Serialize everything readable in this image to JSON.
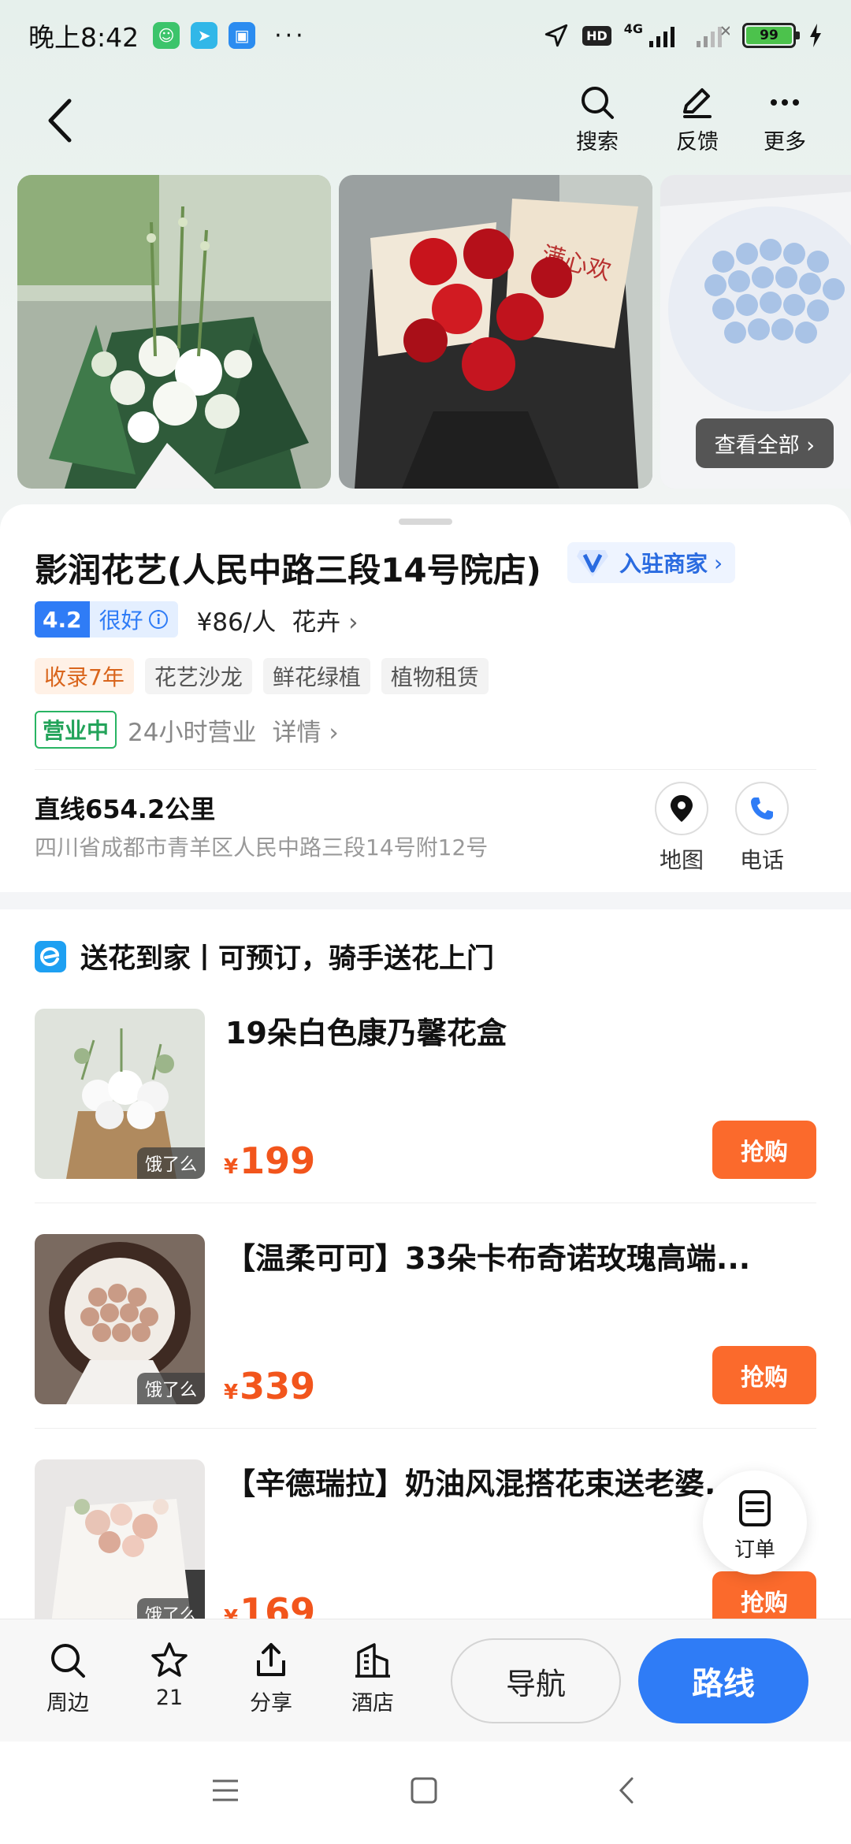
{
  "status_bar": {
    "time": "晚上8:42",
    "network": "4G",
    "hd": "HD",
    "battery": "99",
    "dots": "···"
  },
  "header": {
    "actions": [
      {
        "label": "搜索",
        "icon": "search-icon"
      },
      {
        "label": "反馈",
        "icon": "edit-icon"
      },
      {
        "label": "更多",
        "icon": "more-icon"
      }
    ]
  },
  "gallery": {
    "view_all": "查看全部"
  },
  "shop": {
    "name": "影润花艺(人民中路三段14号院店)",
    "merchant_badge": "入驻商家",
    "rating": "4.2",
    "rating_label": "很好",
    "price": "¥86/人",
    "category": "花卉",
    "tags": [
      "收录7年",
      "花艺沙龙",
      "鲜花绿植",
      "植物租赁"
    ],
    "status": "营业中",
    "hours": "24小时营业",
    "details": "详情",
    "distance": "直线654.2公里",
    "address": "四川省成都市青羊区人民中路三段14号附12号",
    "map_label": "地图",
    "phone_label": "电话"
  },
  "delivery": {
    "title": "送花到家丨可预订，骑手送花上门",
    "products": [
      {
        "name": "19朵白色康乃馨花盒",
        "price": "199",
        "currency": "¥",
        "source": "饿了么",
        "buy": "抢购"
      },
      {
        "name": "【温柔可可】33朵卡布奇诺玫瑰高端...",
        "price": "339",
        "currency": "¥",
        "source": "饿了么",
        "buy": "抢购"
      },
      {
        "name": "【辛德瑞拉】奶油风混搭花束送老婆...",
        "price": "169",
        "currency": "¥",
        "source": "饿了么",
        "buy": "抢购"
      }
    ]
  },
  "order_float": {
    "label": "订单"
  },
  "bottom_bar": {
    "nearby": "周边",
    "favorites": "21",
    "share": "分享",
    "hotel": "酒店",
    "navigate": "导航",
    "route": "路线"
  },
  "colors": {
    "accent_blue": "#2f7cf6",
    "price_orange": "#f2551c",
    "buy_orange": "#fb6a2c",
    "open_green": "#23a35a"
  }
}
